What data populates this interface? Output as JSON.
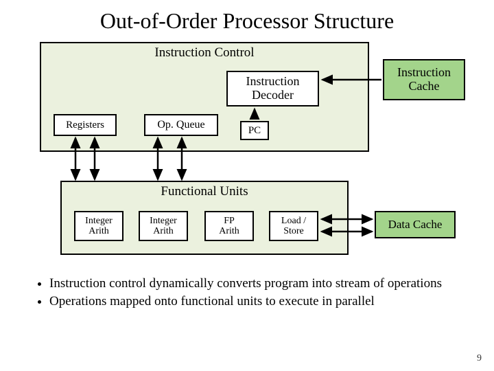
{
  "title": "Out-of-Order Processor Structure",
  "diagram": {
    "instruction_control": {
      "label": "Instruction Control",
      "decoder": "Instruction\nDecoder",
      "registers": "Registers",
      "op_queue": "Op. Queue",
      "pc": "PC",
      "instruction_cache": "Instruction\nCache"
    },
    "functional_units": {
      "label": "Functional Units",
      "units": [
        "Integer\nArith",
        "Integer\nArith",
        "FP\nArith",
        "Load /\nStore"
      ],
      "data_cache": "Data Cache"
    }
  },
  "bullets": [
    "Instruction control dynamically converts program into stream of operations",
    "Operations mapped onto functional units to execute in parallel"
  ],
  "page_number": "9"
}
